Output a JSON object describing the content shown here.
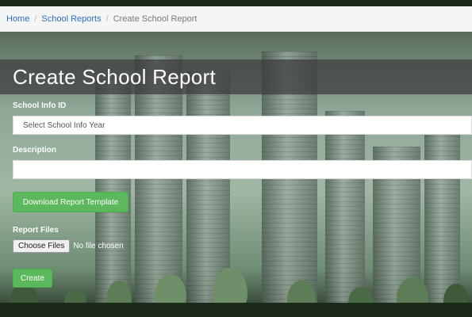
{
  "breadcrumb": {
    "home": "Home",
    "separator": "/",
    "school_reports": "School Reports",
    "current": "Create School Report"
  },
  "page": {
    "title": "Create School Report"
  },
  "form": {
    "school_info_label": "School Info ID",
    "school_info_placeholder": "Select School Info Year",
    "description_label": "Description",
    "description_value": "",
    "download_template_button": "Download Report Template",
    "report_files_label": "Report Files",
    "choose_files_button": "Choose Files",
    "no_file_text": "No file chosen",
    "create_button": "Create"
  },
  "colors": {
    "link": "#2a6ec0",
    "button_green": "#5cb85c",
    "breadcrumb_bg": "#f5f5f5"
  }
}
